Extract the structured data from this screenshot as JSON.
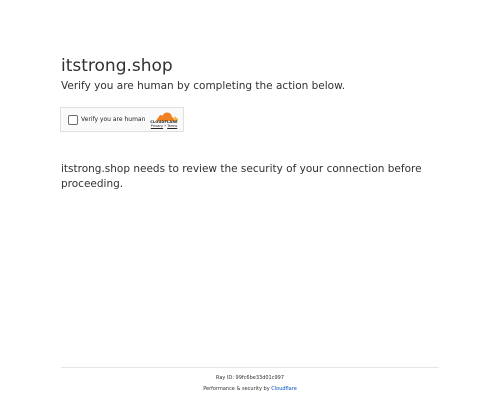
{
  "header": {
    "domain": "itstrong.shop",
    "subtitle": "Verify you are human by completing the action below."
  },
  "challenge_widget": {
    "checkbox_label": "Verify you are human",
    "brand_wordmark": "CLOUDFLARE",
    "privacy_link": "Privacy",
    "link_separator": " • ",
    "terms_link": "Terms",
    "brand_color_primary": "#f38020",
    "brand_color_secondary": "#faae40"
  },
  "main": {
    "message": "itstrong.shop needs to review the security of your connection before proceeding."
  },
  "footer": {
    "ray_id_label": "Ray ID: ",
    "ray_id_value": "99fc6be33d01c997",
    "performance_text": "Performance & security by ",
    "provider_link": "Cloudflare",
    "link_color": "#0051c3"
  }
}
